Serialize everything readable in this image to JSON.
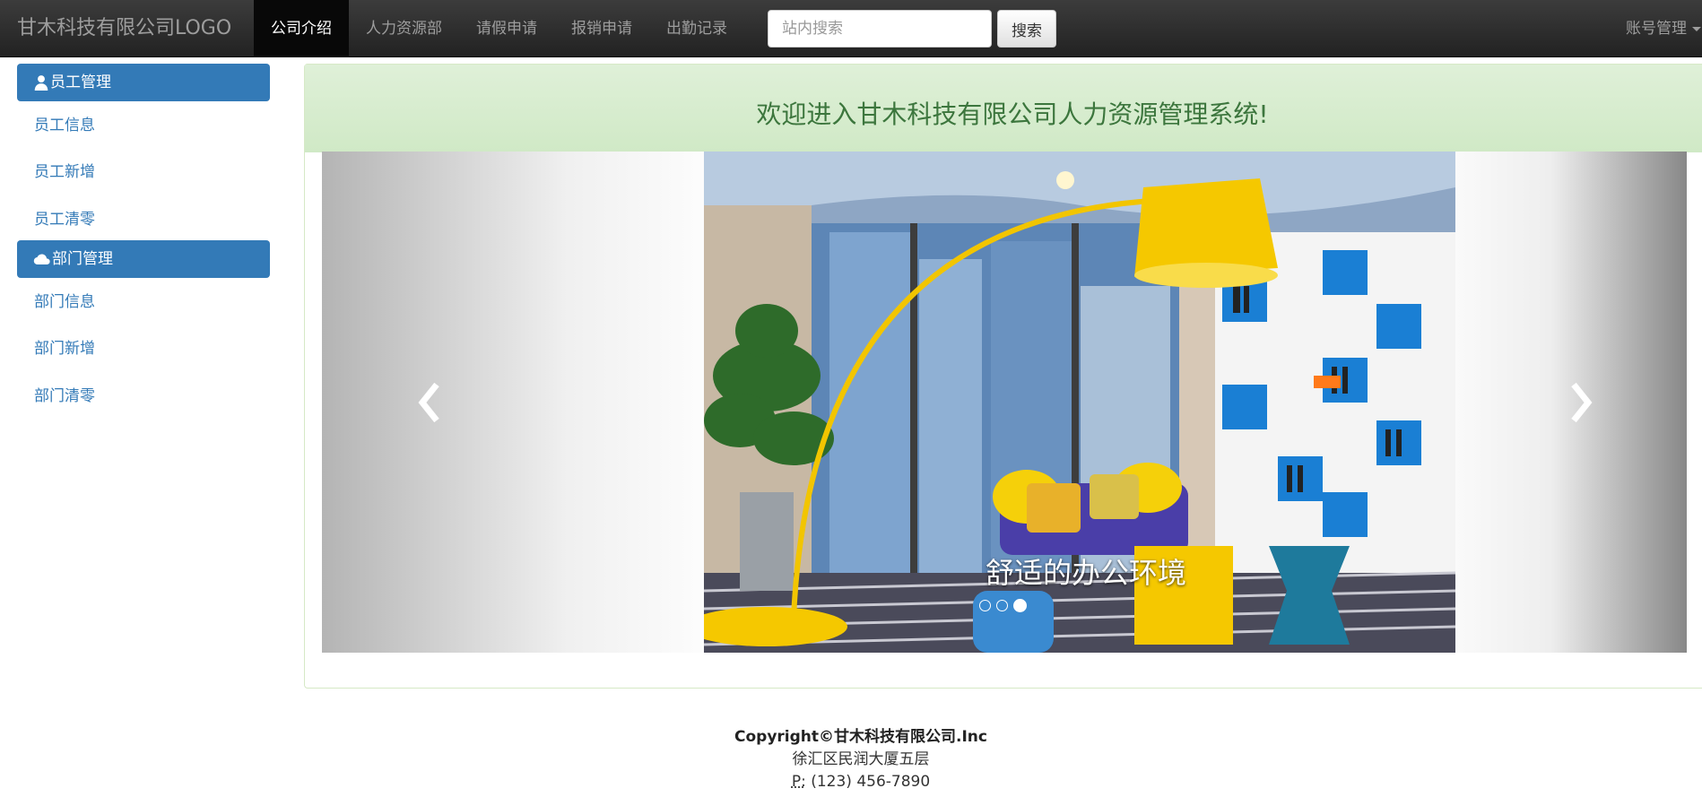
{
  "navbar": {
    "brand": "甘木科技有限公司LOGO",
    "items": [
      {
        "label": "公司介绍",
        "active": true
      },
      {
        "label": "人力资源部"
      },
      {
        "label": "请假申请"
      },
      {
        "label": "报销申请"
      },
      {
        "label": "出勤记录"
      }
    ],
    "search": {
      "placeholder": "站内搜索",
      "button_label": "搜索"
    },
    "account_label": "账号管理"
  },
  "sidebar": {
    "groups": [
      {
        "title": "员工管理",
        "icon": "user-icon",
        "links": [
          "员工信息",
          "员工新增",
          "员工清零"
        ]
      },
      {
        "title": "部门管理",
        "icon": "cloud-icon",
        "links": [
          "部门信息",
          "部门新增",
          "部门清零"
        ]
      }
    ]
  },
  "main": {
    "welcome": "欢迎进入甘木科技有限公司人力资源管理系统!",
    "carousel": {
      "caption": "舒适的办公环境",
      "slide_count": 3,
      "active_index": 2
    }
  },
  "footer": {
    "copyright": "Copyright©甘木科技有限公司.Inc",
    "address": "徐汇区民润大厦五层",
    "phone_abbr": "P:",
    "phone": " (123) 456-7890"
  },
  "colors": {
    "primary": "#337ab7",
    "welcome_text": "#3c763d",
    "welcome_bg": "#dff0d8",
    "navbar": "#222222"
  }
}
